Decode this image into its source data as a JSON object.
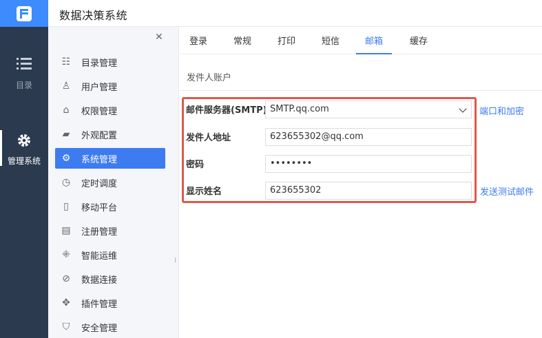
{
  "app": {
    "title": "数据决策系统"
  },
  "icon_nav": [
    {
      "label": "目录",
      "icon": "list-icon"
    },
    {
      "label": "管理系统",
      "icon": "gear-icon",
      "active": true
    }
  ],
  "sidebar": {
    "items": [
      {
        "label": "目录管理",
        "icon": "catalog-icon"
      },
      {
        "label": "用户管理",
        "icon": "user-icon"
      },
      {
        "label": "权限管理",
        "icon": "lock-icon"
      },
      {
        "label": "外观配置",
        "icon": "paint-roller-icon"
      },
      {
        "label": "系统管理",
        "icon": "gear-icon",
        "active": true
      },
      {
        "label": "定时调度",
        "icon": "timer-icon"
      },
      {
        "label": "移动平台",
        "icon": "mobile-icon"
      },
      {
        "label": "注册管理",
        "icon": "register-icon"
      },
      {
        "label": "智能运维",
        "icon": "network-icon"
      },
      {
        "label": "数据连接",
        "icon": "link-icon"
      },
      {
        "label": "插件管理",
        "icon": "puzzle-icon"
      },
      {
        "label": "安全管理",
        "icon": "shield-icon"
      }
    ]
  },
  "tabs": [
    {
      "label": "登录"
    },
    {
      "label": "常规"
    },
    {
      "label": "打印"
    },
    {
      "label": "短信"
    },
    {
      "label": "邮箱",
      "active": true
    },
    {
      "label": "缓存"
    }
  ],
  "mail": {
    "section_title": "发件人账户",
    "smtp_label": "邮件服务器(SMTP)",
    "smtp_value": "SMTP.qq.com",
    "port_link": "端口和加密",
    "sender_label": "发件人地址",
    "sender_value": "623655302@qq.com",
    "password_label": "密码",
    "password_value": "••••••••",
    "display_name_label": "显示姓名",
    "display_name_value": "623655302",
    "test_link": "发送测试邮件"
  },
  "colors": {
    "accent": "#3d7bf0",
    "nav_bg": "#2b3a4f",
    "highlight_border": "#e0584a"
  }
}
